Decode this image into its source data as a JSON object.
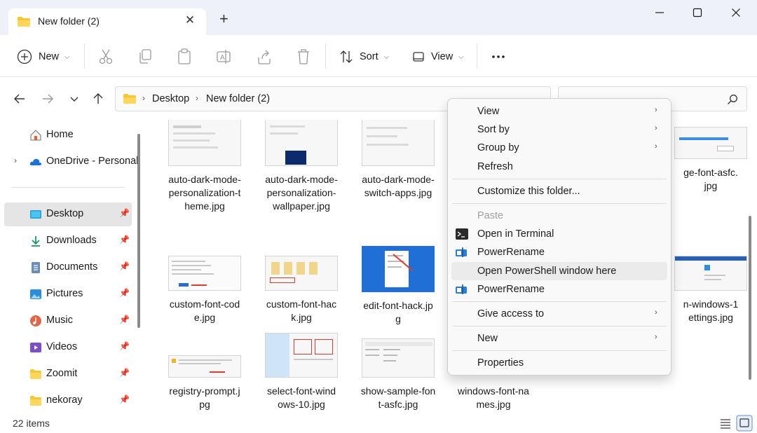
{
  "window": {
    "tab_title": "New folder (2)",
    "close_tab_glyph": "✕",
    "new_tab_glyph": "+"
  },
  "toolbar": {
    "new_label": "New",
    "sort_label": "Sort",
    "view_label": "View"
  },
  "address": {
    "crumbs": [
      "Desktop",
      "New folder (2)"
    ]
  },
  "sidebar": {
    "items": [
      {
        "label": "Home",
        "icon": "home-icon"
      },
      {
        "label": "OneDrive - Personal",
        "icon": "cloud-icon"
      },
      {
        "label": "Desktop",
        "icon": "desktop-icon",
        "selected": true
      },
      {
        "label": "Downloads",
        "icon": "download-icon"
      },
      {
        "label": "Documents",
        "icon": "document-icon"
      },
      {
        "label": "Pictures",
        "icon": "pictures-icon"
      },
      {
        "label": "Music",
        "icon": "music-icon"
      },
      {
        "label": "Videos",
        "icon": "video-icon"
      },
      {
        "label": "Zoomit",
        "icon": "folder-icon"
      },
      {
        "label": "nekoray",
        "icon": "folder-icon"
      }
    ]
  },
  "files": [
    {
      "name": "auto-dark-mode-personalization-theme.jpg",
      "lines": [
        "auto-dark-mode-",
        "personalization-t",
        "heme.jpg"
      ]
    },
    {
      "name": "auto-dark-mode-personalization-wallpaper.jpg",
      "lines": [
        "auto-dark-mode-",
        "personalization-",
        "wallpaper.jpg"
      ]
    },
    {
      "name": "auto-dark-mode-switch-apps.jpg",
      "lines": [
        "auto-dark-mode-",
        "switch-apps.jpg"
      ]
    },
    {
      "name": "change-font-asfc.jpg",
      "lines": [
        "ge-font-asfc.",
        "jpg"
      ]
    },
    {
      "name": "custom-font-code.jpg",
      "lines": [
        "custom-font-cod",
        "e.jpg"
      ]
    },
    {
      "name": "custom-font-hack.jpg",
      "lines": [
        "custom-font-hac",
        "k.jpg"
      ]
    },
    {
      "name": "edit-font-hack.jpg",
      "lines": [
        "edit-font-hack.jp",
        "g"
      ]
    },
    {
      "name": "open-windows-11-settings.jpg",
      "lines": [
        "n-windows-1",
        "ettings.jpg"
      ]
    },
    {
      "name": "registry-prompt.jpg",
      "lines": [
        "registry-prompt.j",
        "pg"
      ]
    },
    {
      "name": "select-font-windows-10.jpg",
      "lines": [
        "select-font-wind",
        "ows-10.jpg"
      ]
    },
    {
      "name": "show-sample-font-asfc.jpg",
      "lines": [
        "show-sample-fon",
        "t-asfc.jpg"
      ]
    },
    {
      "name": "windows-font-names.jpg",
      "lines": [
        "windows-font-na",
        "mes.jpg"
      ]
    }
  ],
  "status": {
    "item_count": "22 items"
  },
  "context_menu": {
    "items": [
      {
        "label": "View",
        "submenu": true
      },
      {
        "label": "Sort by",
        "submenu": true
      },
      {
        "label": "Group by",
        "submenu": true
      },
      {
        "label": "Refresh"
      },
      {
        "label": "Customize this folder..."
      },
      {
        "label": "Paste",
        "disabled": true
      },
      {
        "label": "Open in Terminal",
        "icon": "terminal-icon"
      },
      {
        "label": "PowerRename",
        "icon": "powerrename-icon"
      },
      {
        "label": "Open PowerShell window here",
        "hover": true
      },
      {
        "label": "PowerRename",
        "icon": "powerrename-icon"
      },
      {
        "label": "Give access to",
        "submenu": true
      },
      {
        "label": "New",
        "submenu": true
      },
      {
        "label": "Properties"
      }
    ],
    "submenu_glyph": "›"
  },
  "colors": {
    "titlebar_bg": "#eef2f8",
    "accent": "#0067c0",
    "selected_bg": "#e5e5e5"
  }
}
